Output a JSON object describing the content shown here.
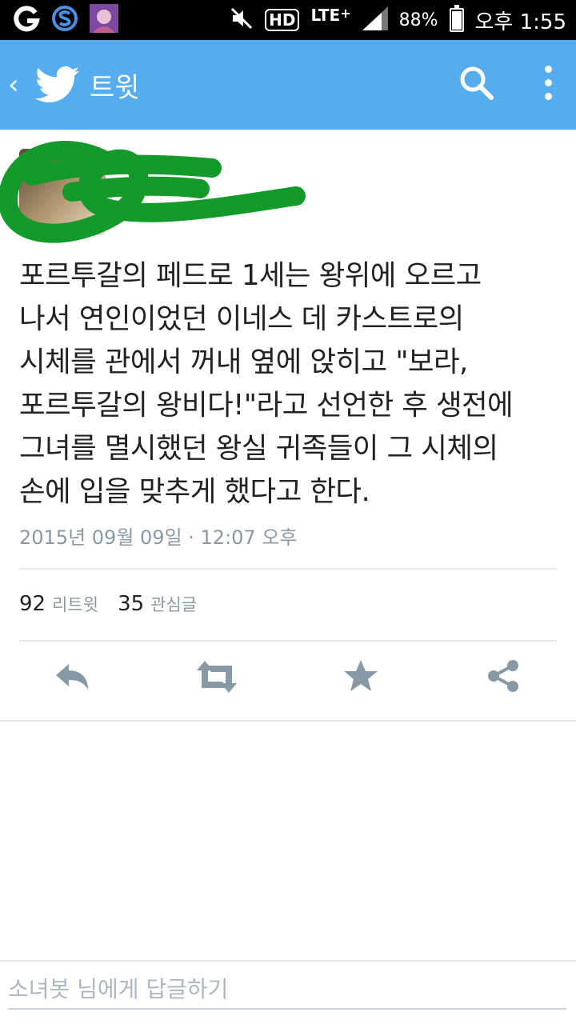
{
  "status_bar": {
    "battery": "88%",
    "network": "LTE",
    "network_plus": "+",
    "hd": "HD",
    "time": "오후 1:55"
  },
  "app_bar": {
    "back": "‹",
    "title": "트윗",
    "accent_color": "#55acee"
  },
  "tweet": {
    "text": "포르투갈의 페드로 1세는 왕위에 오르고\n나서 연인이었던 이네스 데 카스트로의\n시체를 관에서 꺼내 옆에 앉히고 \"보라,\n포르투갈의 왕비다!\"라고 선언한 후 생전에\n그녀를 멸시했던 왕실 귀족들이 그 시체의\n손에 입을 맞추게 했다고 한다.",
    "timestamp": "2015년 09월 09일 · 12:07 오후",
    "retweet_count": "92",
    "retweet_label": "리트윗",
    "favorite_count": "35",
    "favorite_label": "관심글"
  },
  "actions": {
    "reply_icon": "reply-icon",
    "retweet_icon": "retweet-icon",
    "favorite_icon": "star-icon",
    "share_icon": "share-icon",
    "icon_color": "#8899a6"
  },
  "reply": {
    "placeholder": "소녀봇 님에게 답글하기"
  }
}
